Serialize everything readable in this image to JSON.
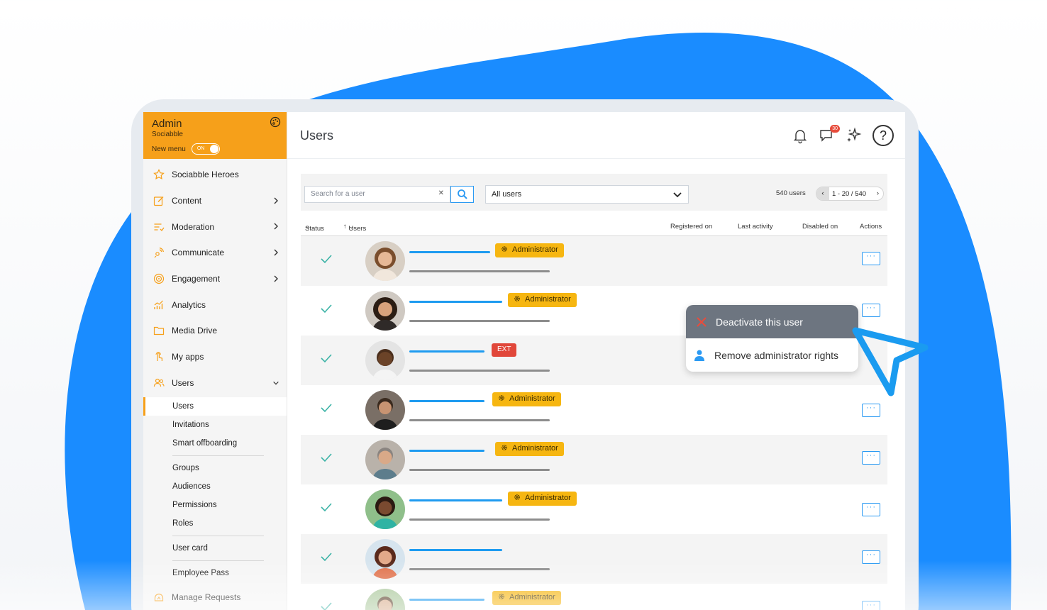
{
  "colors": {
    "accent": "#f6a01a",
    "primary": "#1e9bf0",
    "admin_tag": "#f6b611",
    "ext_tag": "#e1473a",
    "check": "#3bb3a6",
    "backdrop": "#1a8cff"
  },
  "sidebar": {
    "title": "Admin",
    "subtitle": "Sociabble",
    "new_menu_label": "New menu",
    "toggle_state": "ON",
    "items": [
      {
        "label": "Sociabble Heroes",
        "icon": "star-icon",
        "has_submenu": false
      },
      {
        "label": "Content",
        "icon": "edit-icon",
        "has_submenu": true
      },
      {
        "label": "Moderation",
        "icon": "moderation-icon",
        "has_submenu": true
      },
      {
        "label": "Communicate",
        "icon": "broadcast-icon",
        "has_submenu": true
      },
      {
        "label": "Engagement",
        "icon": "target-icon",
        "has_submenu": true
      },
      {
        "label": "Analytics",
        "icon": "analytics-icon",
        "has_submenu": false
      },
      {
        "label": "Media Drive",
        "icon": "folder-icon",
        "has_submenu": false
      },
      {
        "label": "My apps",
        "icon": "tap-icon",
        "has_submenu": false
      },
      {
        "label": "Users",
        "icon": "users-icon",
        "has_submenu": true,
        "expanded": true
      }
    ],
    "users_submenu": {
      "group1": [
        "Users",
        "Invitations",
        "Smart offboarding"
      ],
      "group2": [
        "Groups",
        "Audiences",
        "Permissions",
        "Roles"
      ],
      "group3": [
        "User card"
      ],
      "group4": [
        "Employee Pass"
      ]
    },
    "bottom_item": {
      "label": "Manage Requests",
      "icon": "requests-icon"
    }
  },
  "header": {
    "title": "Users",
    "notification_count": "30"
  },
  "toolbar": {
    "search_placeholder": "Search for a user",
    "filter_value": "All users",
    "user_count": "540 users",
    "pagination": "1 - 20 / 540"
  },
  "table": {
    "columns": {
      "status": "Status",
      "users": "Users",
      "registered": "Registered on",
      "last_activity": "Last activity",
      "disabled": "Disabled on",
      "actions": "Actions"
    },
    "rows": [
      {
        "tag": "Administrator",
        "tag_type": "admin"
      },
      {
        "tag": "Administrator",
        "tag_type": "admin"
      },
      {
        "tag": "EXT",
        "tag_type": "ext"
      },
      {
        "tag": "Administrator",
        "tag_type": "admin"
      },
      {
        "tag": "Administrator",
        "tag_type": "admin"
      },
      {
        "tag": "Administrator",
        "tag_type": "admin"
      },
      {
        "tag": "",
        "tag_type": "none"
      },
      {
        "tag": "Administrator",
        "tag_type": "admin"
      }
    ],
    "actions_label": "···"
  },
  "context_menu": {
    "deactivate": "Deactivate this user",
    "remove_admin": "Remove administrator rights"
  }
}
